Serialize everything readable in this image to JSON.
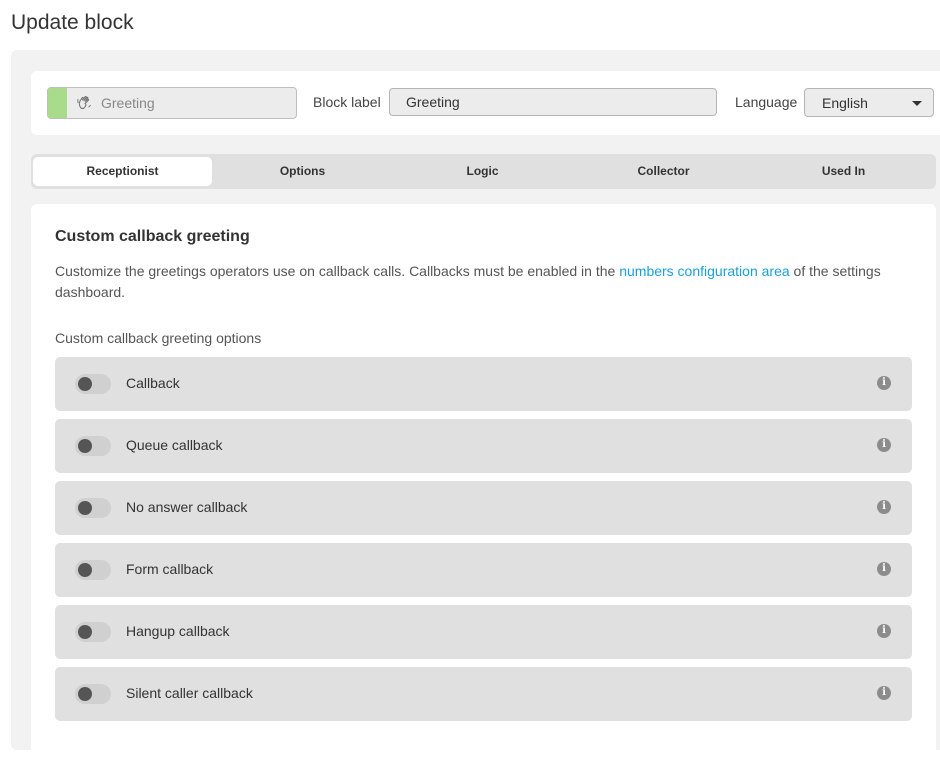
{
  "page": {
    "title": "Update block"
  },
  "block_header": {
    "type_name": "Greeting",
    "type_icon": "waving-hand-icon",
    "type_color": "#a9dc8a",
    "block_label_label": "Block label",
    "block_label_value": "Greeting",
    "language_label": "Language",
    "language_value": "English"
  },
  "tabs": [
    {
      "label": "Receptionist",
      "active": true
    },
    {
      "label": "Options",
      "active": false
    },
    {
      "label": "Logic",
      "active": false
    },
    {
      "label": "Collector",
      "active": false
    },
    {
      "label": "Used In",
      "active": false
    }
  ],
  "section": {
    "title": "Custom callback greeting",
    "description_pre": "Customize the greetings operators use on callback calls. Callbacks must be enabled in the ",
    "description_link": "numbers configuration area",
    "description_post": " of the settings dashboard.",
    "link_color": "#1aa0d8",
    "options_label": "Custom callback greeting options",
    "options": [
      {
        "label": "Callback",
        "enabled": false,
        "info_icon": "info-icon"
      },
      {
        "label": "Queue callback",
        "enabled": false,
        "info_icon": "info-icon"
      },
      {
        "label": "No answer callback",
        "enabled": false,
        "info_icon": "info-icon"
      },
      {
        "label": "Form callback",
        "enabled": false,
        "info_icon": "info-icon"
      },
      {
        "label": "Hangup callback",
        "enabled": false,
        "info_icon": "info-icon"
      },
      {
        "label": "Silent caller callback",
        "enabled": false,
        "info_icon": "info-icon"
      }
    ]
  }
}
